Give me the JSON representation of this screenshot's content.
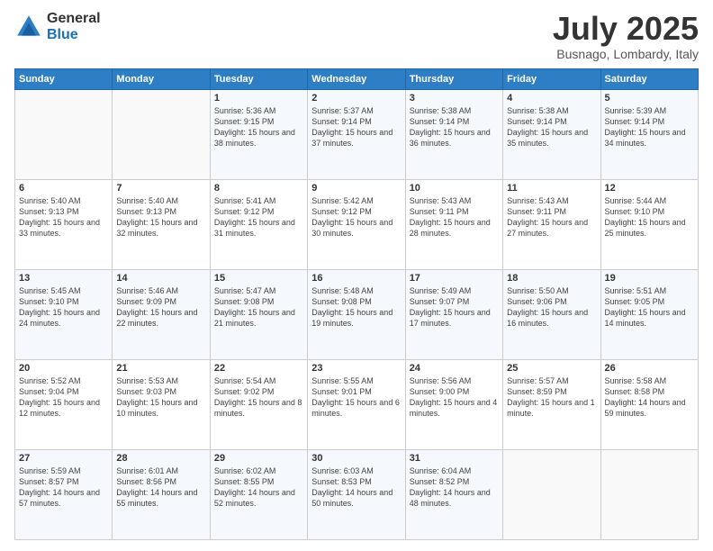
{
  "logo": {
    "general": "General",
    "blue": "Blue"
  },
  "header": {
    "month": "July 2025",
    "location": "Busnago, Lombardy, Italy"
  },
  "weekdays": [
    "Sunday",
    "Monday",
    "Tuesday",
    "Wednesday",
    "Thursday",
    "Friday",
    "Saturday"
  ],
  "weeks": [
    [
      {
        "day": "",
        "sunrise": "",
        "sunset": "",
        "daylight": ""
      },
      {
        "day": "",
        "sunrise": "",
        "sunset": "",
        "daylight": ""
      },
      {
        "day": "1",
        "sunrise": "Sunrise: 5:36 AM",
        "sunset": "Sunset: 9:15 PM",
        "daylight": "Daylight: 15 hours and 38 minutes."
      },
      {
        "day": "2",
        "sunrise": "Sunrise: 5:37 AM",
        "sunset": "Sunset: 9:14 PM",
        "daylight": "Daylight: 15 hours and 37 minutes."
      },
      {
        "day": "3",
        "sunrise": "Sunrise: 5:38 AM",
        "sunset": "Sunset: 9:14 PM",
        "daylight": "Daylight: 15 hours and 36 minutes."
      },
      {
        "day": "4",
        "sunrise": "Sunrise: 5:38 AM",
        "sunset": "Sunset: 9:14 PM",
        "daylight": "Daylight: 15 hours and 35 minutes."
      },
      {
        "day": "5",
        "sunrise": "Sunrise: 5:39 AM",
        "sunset": "Sunset: 9:14 PM",
        "daylight": "Daylight: 15 hours and 34 minutes."
      }
    ],
    [
      {
        "day": "6",
        "sunrise": "Sunrise: 5:40 AM",
        "sunset": "Sunset: 9:13 PM",
        "daylight": "Daylight: 15 hours and 33 minutes."
      },
      {
        "day": "7",
        "sunrise": "Sunrise: 5:40 AM",
        "sunset": "Sunset: 9:13 PM",
        "daylight": "Daylight: 15 hours and 32 minutes."
      },
      {
        "day": "8",
        "sunrise": "Sunrise: 5:41 AM",
        "sunset": "Sunset: 9:12 PM",
        "daylight": "Daylight: 15 hours and 31 minutes."
      },
      {
        "day": "9",
        "sunrise": "Sunrise: 5:42 AM",
        "sunset": "Sunset: 9:12 PM",
        "daylight": "Daylight: 15 hours and 30 minutes."
      },
      {
        "day": "10",
        "sunrise": "Sunrise: 5:43 AM",
        "sunset": "Sunset: 9:11 PM",
        "daylight": "Daylight: 15 hours and 28 minutes."
      },
      {
        "day": "11",
        "sunrise": "Sunrise: 5:43 AM",
        "sunset": "Sunset: 9:11 PM",
        "daylight": "Daylight: 15 hours and 27 minutes."
      },
      {
        "day": "12",
        "sunrise": "Sunrise: 5:44 AM",
        "sunset": "Sunset: 9:10 PM",
        "daylight": "Daylight: 15 hours and 25 minutes."
      }
    ],
    [
      {
        "day": "13",
        "sunrise": "Sunrise: 5:45 AM",
        "sunset": "Sunset: 9:10 PM",
        "daylight": "Daylight: 15 hours and 24 minutes."
      },
      {
        "day": "14",
        "sunrise": "Sunrise: 5:46 AM",
        "sunset": "Sunset: 9:09 PM",
        "daylight": "Daylight: 15 hours and 22 minutes."
      },
      {
        "day": "15",
        "sunrise": "Sunrise: 5:47 AM",
        "sunset": "Sunset: 9:08 PM",
        "daylight": "Daylight: 15 hours and 21 minutes."
      },
      {
        "day": "16",
        "sunrise": "Sunrise: 5:48 AM",
        "sunset": "Sunset: 9:08 PM",
        "daylight": "Daylight: 15 hours and 19 minutes."
      },
      {
        "day": "17",
        "sunrise": "Sunrise: 5:49 AM",
        "sunset": "Sunset: 9:07 PM",
        "daylight": "Daylight: 15 hours and 17 minutes."
      },
      {
        "day": "18",
        "sunrise": "Sunrise: 5:50 AM",
        "sunset": "Sunset: 9:06 PM",
        "daylight": "Daylight: 15 hours and 16 minutes."
      },
      {
        "day": "19",
        "sunrise": "Sunrise: 5:51 AM",
        "sunset": "Sunset: 9:05 PM",
        "daylight": "Daylight: 15 hours and 14 minutes."
      }
    ],
    [
      {
        "day": "20",
        "sunrise": "Sunrise: 5:52 AM",
        "sunset": "Sunset: 9:04 PM",
        "daylight": "Daylight: 15 hours and 12 minutes."
      },
      {
        "day": "21",
        "sunrise": "Sunrise: 5:53 AM",
        "sunset": "Sunset: 9:03 PM",
        "daylight": "Daylight: 15 hours and 10 minutes."
      },
      {
        "day": "22",
        "sunrise": "Sunrise: 5:54 AM",
        "sunset": "Sunset: 9:02 PM",
        "daylight": "Daylight: 15 hours and 8 minutes."
      },
      {
        "day": "23",
        "sunrise": "Sunrise: 5:55 AM",
        "sunset": "Sunset: 9:01 PM",
        "daylight": "Daylight: 15 hours and 6 minutes."
      },
      {
        "day": "24",
        "sunrise": "Sunrise: 5:56 AM",
        "sunset": "Sunset: 9:00 PM",
        "daylight": "Daylight: 15 hours and 4 minutes."
      },
      {
        "day": "25",
        "sunrise": "Sunrise: 5:57 AM",
        "sunset": "Sunset: 8:59 PM",
        "daylight": "Daylight: 15 hours and 1 minute."
      },
      {
        "day": "26",
        "sunrise": "Sunrise: 5:58 AM",
        "sunset": "Sunset: 8:58 PM",
        "daylight": "Daylight: 14 hours and 59 minutes."
      }
    ],
    [
      {
        "day": "27",
        "sunrise": "Sunrise: 5:59 AM",
        "sunset": "Sunset: 8:57 PM",
        "daylight": "Daylight: 14 hours and 57 minutes."
      },
      {
        "day": "28",
        "sunrise": "Sunrise: 6:01 AM",
        "sunset": "Sunset: 8:56 PM",
        "daylight": "Daylight: 14 hours and 55 minutes."
      },
      {
        "day": "29",
        "sunrise": "Sunrise: 6:02 AM",
        "sunset": "Sunset: 8:55 PM",
        "daylight": "Daylight: 14 hours and 52 minutes."
      },
      {
        "day": "30",
        "sunrise": "Sunrise: 6:03 AM",
        "sunset": "Sunset: 8:53 PM",
        "daylight": "Daylight: 14 hours and 50 minutes."
      },
      {
        "day": "31",
        "sunrise": "Sunrise: 6:04 AM",
        "sunset": "Sunset: 8:52 PM",
        "daylight": "Daylight: 14 hours and 48 minutes."
      },
      {
        "day": "",
        "sunrise": "",
        "sunset": "",
        "daylight": ""
      },
      {
        "day": "",
        "sunrise": "",
        "sunset": "",
        "daylight": ""
      }
    ]
  ]
}
